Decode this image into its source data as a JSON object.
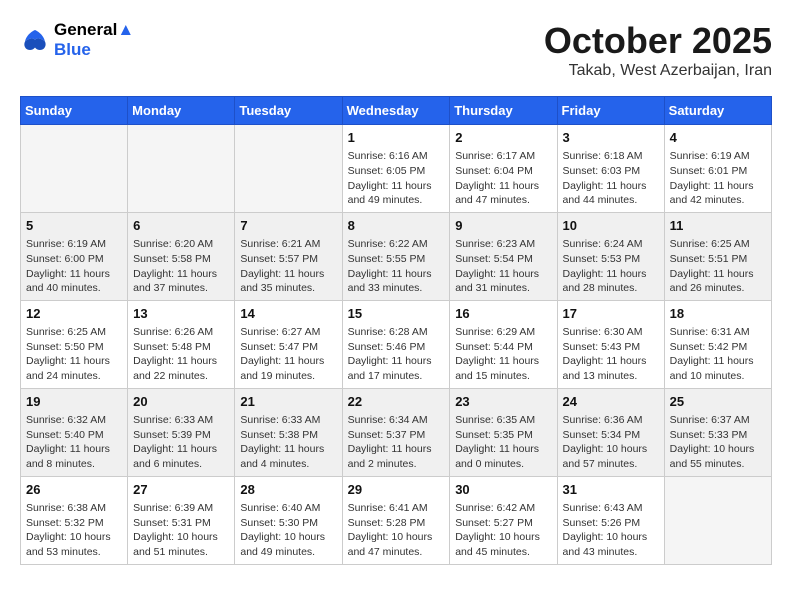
{
  "header": {
    "logo": {
      "line1": "General",
      "line2": "Blue"
    },
    "month": "October 2025",
    "location": "Takab, West Azerbaijan, Iran"
  },
  "weekdays": [
    "Sunday",
    "Monday",
    "Tuesday",
    "Wednesday",
    "Thursday",
    "Friday",
    "Saturday"
  ],
  "weeks": [
    {
      "shaded": false,
      "days": [
        {
          "num": "",
          "info": ""
        },
        {
          "num": "",
          "info": ""
        },
        {
          "num": "",
          "info": ""
        },
        {
          "num": "1",
          "info": "Sunrise: 6:16 AM\nSunset: 6:05 PM\nDaylight: 11 hours\nand 49 minutes."
        },
        {
          "num": "2",
          "info": "Sunrise: 6:17 AM\nSunset: 6:04 PM\nDaylight: 11 hours\nand 47 minutes."
        },
        {
          "num": "3",
          "info": "Sunrise: 6:18 AM\nSunset: 6:03 PM\nDaylight: 11 hours\nand 44 minutes."
        },
        {
          "num": "4",
          "info": "Sunrise: 6:19 AM\nSunset: 6:01 PM\nDaylight: 11 hours\nand 42 minutes."
        }
      ]
    },
    {
      "shaded": true,
      "days": [
        {
          "num": "5",
          "info": "Sunrise: 6:19 AM\nSunset: 6:00 PM\nDaylight: 11 hours\nand 40 minutes."
        },
        {
          "num": "6",
          "info": "Sunrise: 6:20 AM\nSunset: 5:58 PM\nDaylight: 11 hours\nand 37 minutes."
        },
        {
          "num": "7",
          "info": "Sunrise: 6:21 AM\nSunset: 5:57 PM\nDaylight: 11 hours\nand 35 minutes."
        },
        {
          "num": "8",
          "info": "Sunrise: 6:22 AM\nSunset: 5:55 PM\nDaylight: 11 hours\nand 33 minutes."
        },
        {
          "num": "9",
          "info": "Sunrise: 6:23 AM\nSunset: 5:54 PM\nDaylight: 11 hours\nand 31 minutes."
        },
        {
          "num": "10",
          "info": "Sunrise: 6:24 AM\nSunset: 5:53 PM\nDaylight: 11 hours\nand 28 minutes."
        },
        {
          "num": "11",
          "info": "Sunrise: 6:25 AM\nSunset: 5:51 PM\nDaylight: 11 hours\nand 26 minutes."
        }
      ]
    },
    {
      "shaded": false,
      "days": [
        {
          "num": "12",
          "info": "Sunrise: 6:25 AM\nSunset: 5:50 PM\nDaylight: 11 hours\nand 24 minutes."
        },
        {
          "num": "13",
          "info": "Sunrise: 6:26 AM\nSunset: 5:48 PM\nDaylight: 11 hours\nand 22 minutes."
        },
        {
          "num": "14",
          "info": "Sunrise: 6:27 AM\nSunset: 5:47 PM\nDaylight: 11 hours\nand 19 minutes."
        },
        {
          "num": "15",
          "info": "Sunrise: 6:28 AM\nSunset: 5:46 PM\nDaylight: 11 hours\nand 17 minutes."
        },
        {
          "num": "16",
          "info": "Sunrise: 6:29 AM\nSunset: 5:44 PM\nDaylight: 11 hours\nand 15 minutes."
        },
        {
          "num": "17",
          "info": "Sunrise: 6:30 AM\nSunset: 5:43 PM\nDaylight: 11 hours\nand 13 minutes."
        },
        {
          "num": "18",
          "info": "Sunrise: 6:31 AM\nSunset: 5:42 PM\nDaylight: 11 hours\nand 10 minutes."
        }
      ]
    },
    {
      "shaded": true,
      "days": [
        {
          "num": "19",
          "info": "Sunrise: 6:32 AM\nSunset: 5:40 PM\nDaylight: 11 hours\nand 8 minutes."
        },
        {
          "num": "20",
          "info": "Sunrise: 6:33 AM\nSunset: 5:39 PM\nDaylight: 11 hours\nand 6 minutes."
        },
        {
          "num": "21",
          "info": "Sunrise: 6:33 AM\nSunset: 5:38 PM\nDaylight: 11 hours\nand 4 minutes."
        },
        {
          "num": "22",
          "info": "Sunrise: 6:34 AM\nSunset: 5:37 PM\nDaylight: 11 hours\nand 2 minutes."
        },
        {
          "num": "23",
          "info": "Sunrise: 6:35 AM\nSunset: 5:35 PM\nDaylight: 11 hours\nand 0 minutes."
        },
        {
          "num": "24",
          "info": "Sunrise: 6:36 AM\nSunset: 5:34 PM\nDaylight: 10 hours\nand 57 minutes."
        },
        {
          "num": "25",
          "info": "Sunrise: 6:37 AM\nSunset: 5:33 PM\nDaylight: 10 hours\nand 55 minutes."
        }
      ]
    },
    {
      "shaded": false,
      "days": [
        {
          "num": "26",
          "info": "Sunrise: 6:38 AM\nSunset: 5:32 PM\nDaylight: 10 hours\nand 53 minutes."
        },
        {
          "num": "27",
          "info": "Sunrise: 6:39 AM\nSunset: 5:31 PM\nDaylight: 10 hours\nand 51 minutes."
        },
        {
          "num": "28",
          "info": "Sunrise: 6:40 AM\nSunset: 5:30 PM\nDaylight: 10 hours\nand 49 minutes."
        },
        {
          "num": "29",
          "info": "Sunrise: 6:41 AM\nSunset: 5:28 PM\nDaylight: 10 hours\nand 47 minutes."
        },
        {
          "num": "30",
          "info": "Sunrise: 6:42 AM\nSunset: 5:27 PM\nDaylight: 10 hours\nand 45 minutes."
        },
        {
          "num": "31",
          "info": "Sunrise: 6:43 AM\nSunset: 5:26 PM\nDaylight: 10 hours\nand 43 minutes."
        },
        {
          "num": "",
          "info": ""
        }
      ]
    }
  ]
}
